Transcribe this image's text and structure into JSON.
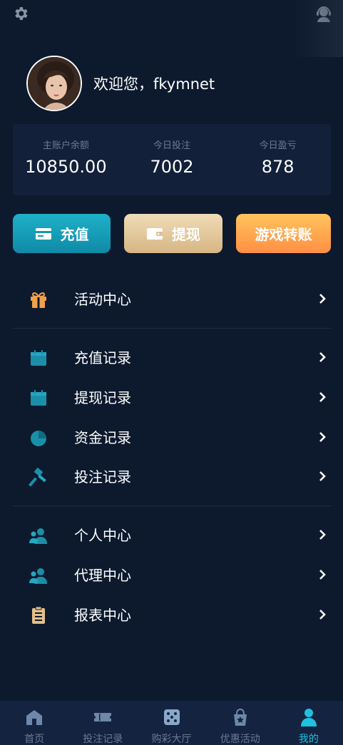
{
  "user": {
    "greeting": "欢迎您，fkymnet"
  },
  "stats": [
    {
      "label": "主账户余额",
      "value": "10850.00"
    },
    {
      "label": "今日投注",
      "value": "7002"
    },
    {
      "label": "今日盈亏",
      "value": "878"
    }
  ],
  "actions": {
    "recharge": "充值",
    "withdraw": "提现",
    "transfer": "游戏转账"
  },
  "menu": {
    "activity": "活动中心",
    "recharge_records": "充值记录",
    "withdraw_records": "提现记录",
    "fund_records": "资金记录",
    "bet_records": "投注记录",
    "personal_center": "个人中心",
    "agent_center": "代理中心",
    "report_center": "报表中心"
  },
  "tabs": [
    {
      "label": "首页",
      "icon": "home-icon"
    },
    {
      "label": "投注记录",
      "icon": "ticket-icon"
    },
    {
      "label": "购彩大厅",
      "icon": "dice-icon"
    },
    {
      "label": "优惠活动",
      "icon": "gift-bag-icon"
    },
    {
      "label": "我的",
      "icon": "user-icon",
      "active": true
    }
  ],
  "colors": {
    "background": "#0d1a2e",
    "card": "#12203a",
    "accent": "#1fc0e0",
    "icon_teal": "#1b8fa8",
    "gold": "#e3c08a",
    "orange": "#ff9a48"
  }
}
